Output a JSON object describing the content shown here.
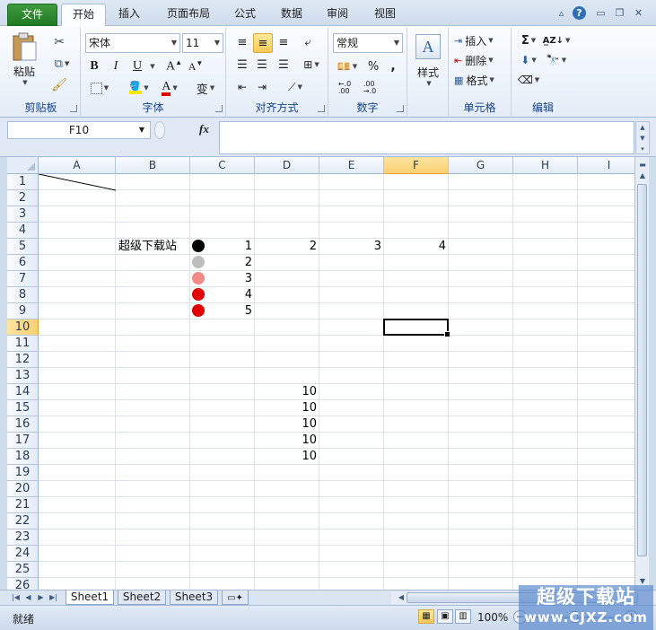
{
  "tabs": {
    "file": "文件",
    "home": "开始",
    "insert": "插入",
    "page_layout": "页面布局",
    "formulas": "公式",
    "data": "数据",
    "review": "审阅",
    "view": "视图"
  },
  "ribbon": {
    "clipboard": {
      "paste": "粘贴",
      "label": "剪贴板"
    },
    "font": {
      "name": "宋体",
      "size": "11",
      "label": "字体",
      "bold": "B",
      "italic": "I",
      "underline": "U",
      "color_glyph": "A",
      "phonetic": "变"
    },
    "alignment": {
      "label": "对齐方式"
    },
    "number": {
      "format": "常规",
      "percent": "%",
      "comma": ",",
      "label": "数字"
    },
    "styles": {
      "label": "样式"
    },
    "cells": {
      "insert": "插入",
      "delete": "删除",
      "format": "格式",
      "label": "单元格"
    },
    "editing": {
      "sum": "Σ",
      "label": "编辑"
    }
  },
  "formula_bar": {
    "name_box": "F10",
    "fx": "fx",
    "value": ""
  },
  "columns": [
    "A",
    "B",
    "C",
    "D",
    "E",
    "F",
    "G",
    "H",
    "I"
  ],
  "active_column": "F",
  "rows": [
    "1",
    "2",
    "3",
    "4",
    "5",
    "6",
    "7",
    "8",
    "9",
    "10",
    "11",
    "12",
    "13",
    "14",
    "15",
    "16",
    "17",
    "18",
    "19",
    "20",
    "21",
    "22",
    "23",
    "24",
    "25",
    "26"
  ],
  "active_row": "10",
  "cells": {
    "B5": "超级下载站",
    "C5": "1",
    "D5": "2",
    "E5": "3",
    "F5": "4",
    "C6": "2",
    "C7": "3",
    "C8": "4",
    "C9": "5",
    "D14": "10",
    "D15": "10",
    "D16": "10",
    "D17": "10",
    "D18": "10"
  },
  "dot_colors": {
    "row5": "#000000",
    "row6": "#bdbdbd",
    "row7": "#f28a8a",
    "row8": "#e00000",
    "row9": "#e00000"
  },
  "sheets": [
    "Sheet1",
    "Sheet2",
    "Sheet3"
  ],
  "active_sheet": "Sheet1",
  "status": {
    "ready": "就绪",
    "zoom": "100%"
  },
  "watermark": {
    "title": "超级下载站",
    "url": "www.CJXZ.com"
  }
}
